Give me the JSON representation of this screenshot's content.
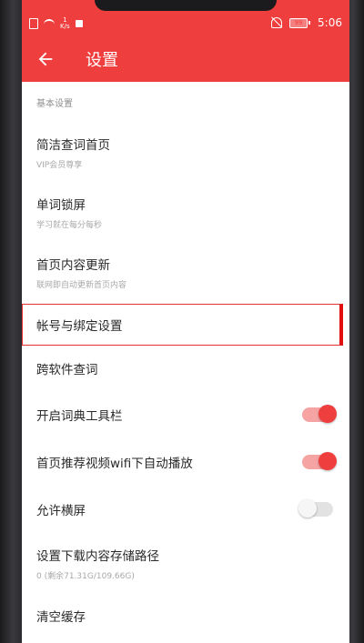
{
  "statusbar": {
    "network_speed_value": "1",
    "network_speed_unit": "K/s",
    "battery": "99",
    "time": "5:06"
  },
  "appbar": {
    "title": "设置"
  },
  "settings": {
    "section_basic": "基本设置",
    "simple_home": {
      "title": "简洁查词首页",
      "subtitle": "VIP会员尊享"
    },
    "lockscreen": {
      "title": "单词锁屏",
      "subtitle": "学习就在每分每秒"
    },
    "home_update": {
      "title": "首页内容更新",
      "subtitle": "联网即自动更新首页内容"
    },
    "account": {
      "title": "帐号与绑定设置"
    },
    "cross_app": {
      "title": "跨软件查词"
    },
    "toolbar": {
      "title": "开启词典工具栏",
      "enabled": true
    },
    "autoplay": {
      "title": "首页推荐视频wifi下自动播放",
      "enabled": true
    },
    "landscape": {
      "title": "允许横屏",
      "enabled": false
    },
    "storage": {
      "title": "设置下载内容存储路径",
      "subtitle": "0 (剩余71.31G/109.66G)"
    },
    "clear_cache": {
      "title": "清空缓存"
    }
  },
  "colors": {
    "brand_red": "#ef3e3e",
    "toggle_on_track": "#f5a3a3",
    "toggle_off_track": "#e2e2e2",
    "highlight": "#e01010"
  }
}
